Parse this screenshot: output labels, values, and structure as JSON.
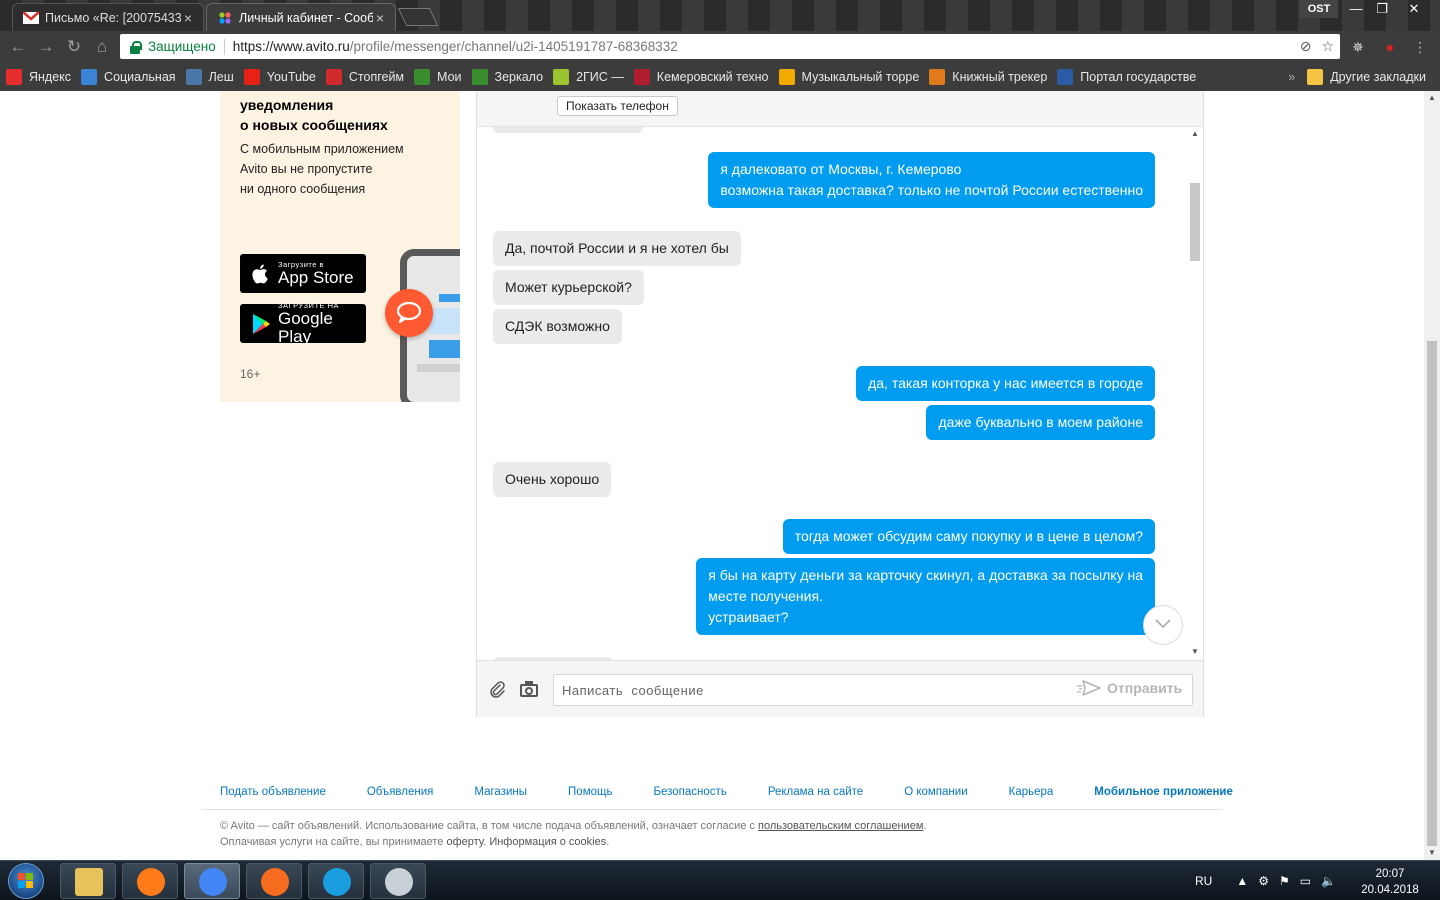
{
  "browser": {
    "tabs": [
      {
        "title": "Письмо «Re: [20075433]",
        "close": "×"
      },
      {
        "title": "Личный кабинет - Сооб",
        "close": "×"
      }
    ],
    "profile_badge": "OST",
    "window_controls": {
      "minimize": "—",
      "restore": "❐",
      "close": "✕"
    },
    "secure_label": "Защищено",
    "url_host": "https://www.avito.ru",
    "url_path": "/profile/messenger/channel/u2i-1405191787-68368332",
    "bookmarks": [
      {
        "label": "Яндекс",
        "icon": "yandex-icon",
        "color": "#e62e2e"
      },
      {
        "label": "Социальная",
        "icon": "social-icon",
        "color": "#3b83d6"
      },
      {
        "label": "Леш",
        "icon": "vk-icon",
        "color": "#4a76a8"
      },
      {
        "label": "YouTube",
        "icon": "youtube-icon",
        "color": "#e62117"
      },
      {
        "label": "Стопгейм",
        "icon": "stopgame-icon",
        "color": "#d02a2a"
      },
      {
        "label": "Мои",
        "icon": "tracker-icon",
        "color": "#3a8d2f"
      },
      {
        "label": "Зеркало",
        "icon": "mirror-icon",
        "color": "#3a8d2f"
      },
      {
        "label": "2ГИС —",
        "icon": "2gis-icon",
        "color": "#9cc431"
      },
      {
        "label": "Кемеровский техно",
        "icon": "kemerovo-icon",
        "color": "#b01e2e"
      },
      {
        "label": "Музыкальный торре",
        "icon": "music-icon",
        "color": "#f2a900"
      },
      {
        "label": "Книжный трекер",
        "icon": "book-icon",
        "color": "#e07a1a"
      },
      {
        "label": "Портал государстве",
        "icon": "gosuslugi-icon",
        "color": "#2c5ba8"
      }
    ],
    "bookmarks_more": "»",
    "other_bookmarks": "Другие закладки"
  },
  "promo": {
    "title_line1": "уведомления",
    "title_line2": "о новых сообщениях",
    "text_line1": "С мобильным приложением",
    "text_line2": "Avito вы не пропустите",
    "text_line3": "ни одного сообщения",
    "appstore_small": "Загрузите в",
    "appstore_big": "App Store",
    "googleplay_small": "ЗАГРУЗИТЕ НА",
    "googleplay_big": "Google Play",
    "age": "16+"
  },
  "messenger": {
    "show_phone": "Показать телефон",
    "messages": [
      {
        "dir": "out",
        "lines": [
          "я далековато от Москвы, г. Кемерово",
          "возможна такая доставка? только не почтой России естественно"
        ]
      },
      {
        "dir": "in",
        "lines": [
          "Да, почтой России и я не хотел бы"
        ]
      },
      {
        "dir": "in",
        "lines": [
          "Может курьерской?"
        ]
      },
      {
        "dir": "in",
        "lines": [
          "СДЭК возможно"
        ]
      },
      {
        "dir": "out",
        "lines": [
          "да, такая конторка у нас имеется в городе"
        ]
      },
      {
        "dir": "out",
        "lines": [
          "даже буквально в моем районе"
        ]
      },
      {
        "dir": "in",
        "lines": [
          "Очень хорошо"
        ]
      },
      {
        "dir": "out",
        "lines": [
          "тогда может обсудим саму покупку и в цене в целом?"
        ]
      },
      {
        "dir": "out",
        "lines": [
          "я бы на карту деньги за карточку скинул, а доставка за посылку на",
          "месте получения.",
          "устраивает?"
        ]
      }
    ],
    "input_placeholder": "Написать  сообщение",
    "send_label": "Отправить"
  },
  "footer": {
    "links": [
      "Подать объявление",
      "Объявления",
      "Магазины",
      "Помощь",
      "Безопасность",
      "Реклама на сайте",
      "О компании",
      "Карьера",
      "Мобильное приложение"
    ],
    "legal_line1_a": "© Avito — сайт объявлений. Использование сайта, в том числе подача объявлений, означает согласие с ",
    "legal_line1_link": "пользовательским соглашением",
    "legal_line1_end": ".",
    "legal_line2_a": "Оплачивая услуги на сайте, вы принимаете ",
    "legal_line2_link1": "оферту",
    "legal_line2_mid": ". ",
    "legal_line2_link2": "Информация о cookies",
    "legal_line2_end": "."
  },
  "taskbar": {
    "apps": [
      {
        "name": "explorer",
        "icon": "folder-icon"
      },
      {
        "name": "firefox",
        "icon": "firefox-icon"
      },
      {
        "name": "chrome",
        "icon": "chrome-icon"
      },
      {
        "name": "origin",
        "icon": "origin-icon"
      },
      {
        "name": "uplay",
        "icon": "uplay-icon"
      },
      {
        "name": "paint",
        "icon": "paint-icon"
      }
    ],
    "language": "RU",
    "time": "20:07",
    "date": "20.04.2018"
  }
}
